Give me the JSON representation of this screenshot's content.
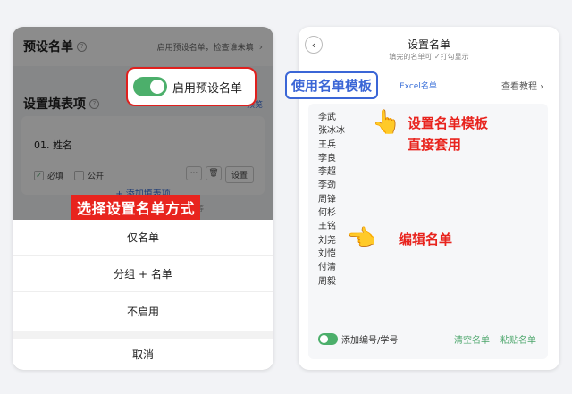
{
  "left_screen": {
    "preset_title": "预设名单",
    "preset_hint": "启用预设名单，检查谁未填",
    "help_glyph": "?",
    "chevron_glyph": "›",
    "form_title": "设置填表项",
    "preview_label": "预览",
    "item_name": "01.  姓名",
    "required_label": "必填",
    "public_label": "公开",
    "more_glyph": "···",
    "delete_glyph": "🗑",
    "settings_label": "设置",
    "check_glyph": "✓",
    "toggle_label": "启用预设名单",
    "add_field_label": "+ 添加填表项",
    "example_hint": "例如：手机号、收货地址、身份证号等",
    "annotation": "选择设置名单方式",
    "sheet_options": [
      "仅名单",
      "分组 + 名单",
      "不启用"
    ],
    "cancel_label": "取消"
  },
  "right_screen": {
    "back_glyph": "‹",
    "title": "设置名单",
    "subtitle": "填完的名单可 ✓打勾显示",
    "template_callout": "使用名单模板",
    "excel_link": "Excel名单",
    "tutorial_link": "查看教程 ›",
    "names": [
      "李武",
      "张冰冰",
      "王兵",
      "李良",
      "李超",
      "李劲",
      "周锋",
      "何杉",
      "王铭",
      "刘尧",
      "刘恺",
      "付清",
      "周毅"
    ],
    "annotation_template": "设置名单模板\n直接套用",
    "annotation_edit": "编辑名单",
    "hand_up": "👆",
    "hand_left": "👈",
    "add_number_label": "添加编号/学号",
    "clear_label": "清空名单",
    "paste_label": "粘贴名单"
  },
  "colors": {
    "accent_blue": "#3b66d6",
    "annotation_red": "#e8241e",
    "toggle_green": "#4caf6b"
  },
  "icons": [
    "help-icon",
    "chevron-right-icon",
    "check-icon",
    "more-icon",
    "trash-icon",
    "back-icon",
    "pointing-up-hand-icon",
    "pointing-left-hand-icon"
  ]
}
